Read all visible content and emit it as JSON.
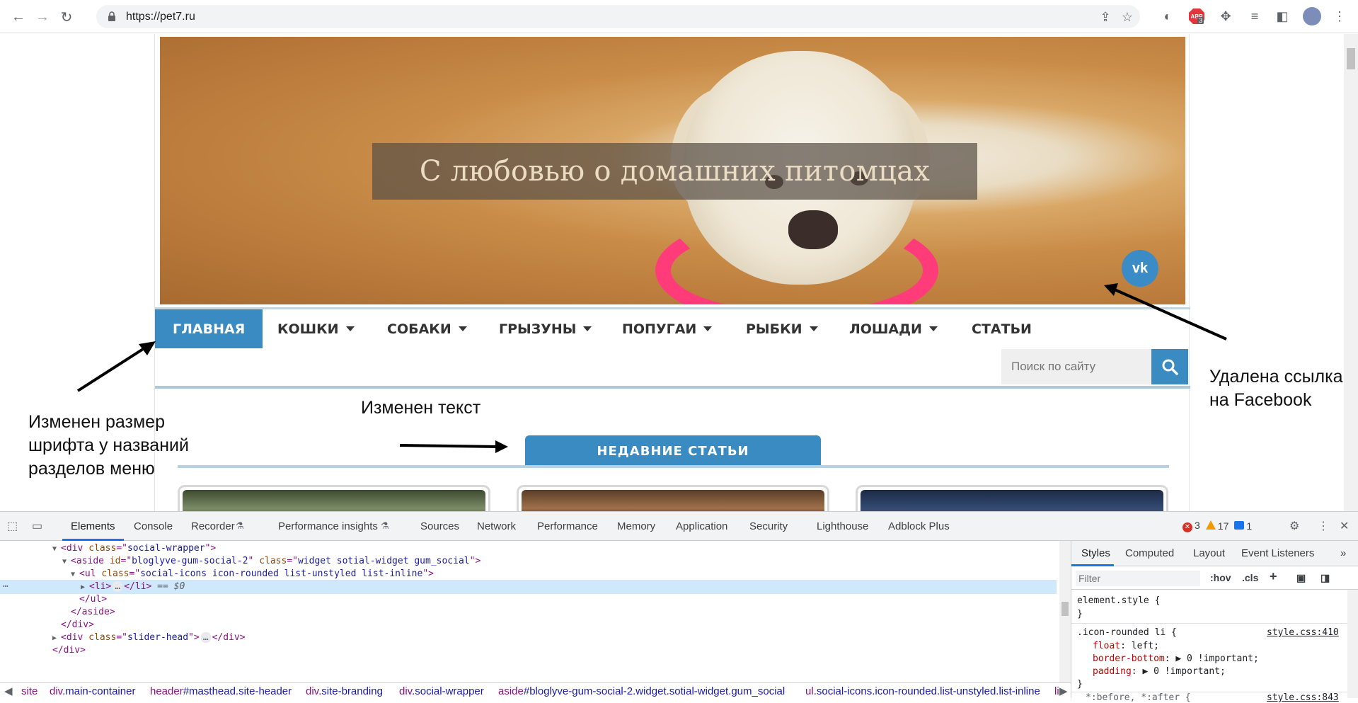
{
  "browser": {
    "url": "https://pet7.ru",
    "extension_badge": "3"
  },
  "site": {
    "hero_title": "С любовью о домашних питомцах",
    "vk_label": "vk",
    "menu": [
      {
        "label": "ГЛАВНАЯ",
        "active": true,
        "dropdown": false
      },
      {
        "label": "КОШКИ",
        "active": false,
        "dropdown": true
      },
      {
        "label": "СОБАКИ",
        "active": false,
        "dropdown": true
      },
      {
        "label": "ГРЫЗУНЫ",
        "active": false,
        "dropdown": true
      },
      {
        "label": "ПОПУГАИ",
        "active": false,
        "dropdown": true
      },
      {
        "label": "РЫБКИ",
        "active": false,
        "dropdown": true
      },
      {
        "label": "ЛОШАДИ",
        "active": false,
        "dropdown": true
      },
      {
        "label": "СТАТЬИ",
        "active": false,
        "dropdown": false
      }
    ],
    "search_placeholder": "Поиск по сайту",
    "recent_heading": "НЕДАВНИЕ СТАТЬИ",
    "accent_color": "#3a8bc2"
  },
  "annotations": {
    "menu_font": "Изменен размер шрифта у названий разделов меню",
    "menu_font_lines": [
      "Изменен размер",
      "шрифта у названий",
      "разделов меню"
    ],
    "text_changed": "Изменен текст",
    "facebook_removed_lines": [
      "Удалена ссылка",
      "на Facebook"
    ]
  },
  "devtools": {
    "tabs": [
      "Elements",
      "Console",
      "Recorder",
      "Performance insights",
      "Sources",
      "Network",
      "Performance",
      "Memory",
      "Application",
      "Security",
      "Lighthouse",
      "Adblock Plus"
    ],
    "active_tab": "Elements",
    "errors": "3",
    "warnings": "17",
    "info": "1",
    "dom_lines": [
      {
        "open": "<div ",
        "attrs": [
          [
            "class",
            "social-wrapper"
          ]
        ],
        "close": ">"
      },
      {
        "open": "<aside ",
        "attrs": [
          [
            "id",
            "bloglyve-gum-social-2"
          ],
          [
            "class",
            "widget sotial-widget gum_social"
          ]
        ],
        "close": ">"
      },
      {
        "open": "<ul ",
        "attrs": [
          [
            "class",
            "social-icons icon-rounded  list-unstyled list-inline"
          ]
        ],
        "close": ">"
      },
      {
        "text": "<li>",
        "middle": "…",
        "end": "</li>",
        "hint": " == $0"
      },
      {
        "text": "</ul>"
      },
      {
        "text": "</aside>"
      },
      {
        "text": "</div>"
      },
      {
        "open": "<div ",
        "attrs": [
          [
            "class",
            "slider-head"
          ]
        ],
        "close": ">",
        "middle": "…",
        "end": "</div>"
      },
      {
        "text": "</div>"
      }
    ],
    "breadcrumbs": [
      "site",
      "div.main-container",
      "header#masthead.site-header",
      "div.site-branding",
      "div.social-wrapper",
      "aside#bloglyve-gum-social-2.widget.sotial-widget.gum_social",
      "ul.social-icons.icon-rounded.list-unstyled.list-inline",
      "li"
    ],
    "styles_tabs": [
      "Styles",
      "Computed",
      "Layout",
      "Event Listeners"
    ],
    "filter_placeholder": "Filter",
    "hov": ":hov",
    "cls": ".cls",
    "element_style": "element.style {",
    "closing_brace": "}",
    "rule_selector": ".icon-rounded li {",
    "rule_source": "style.css:410",
    "rule_props": [
      {
        "name": "float",
        "value": "left;"
      },
      {
        "name": "border-bottom",
        "value": "▶ 0 !important;"
      },
      {
        "name": "padding",
        "value": "▶ 0 !important;"
      }
    ],
    "next_rule_selector": "*:before, *:after {",
    "next_rule_source": "style.css:843"
  }
}
